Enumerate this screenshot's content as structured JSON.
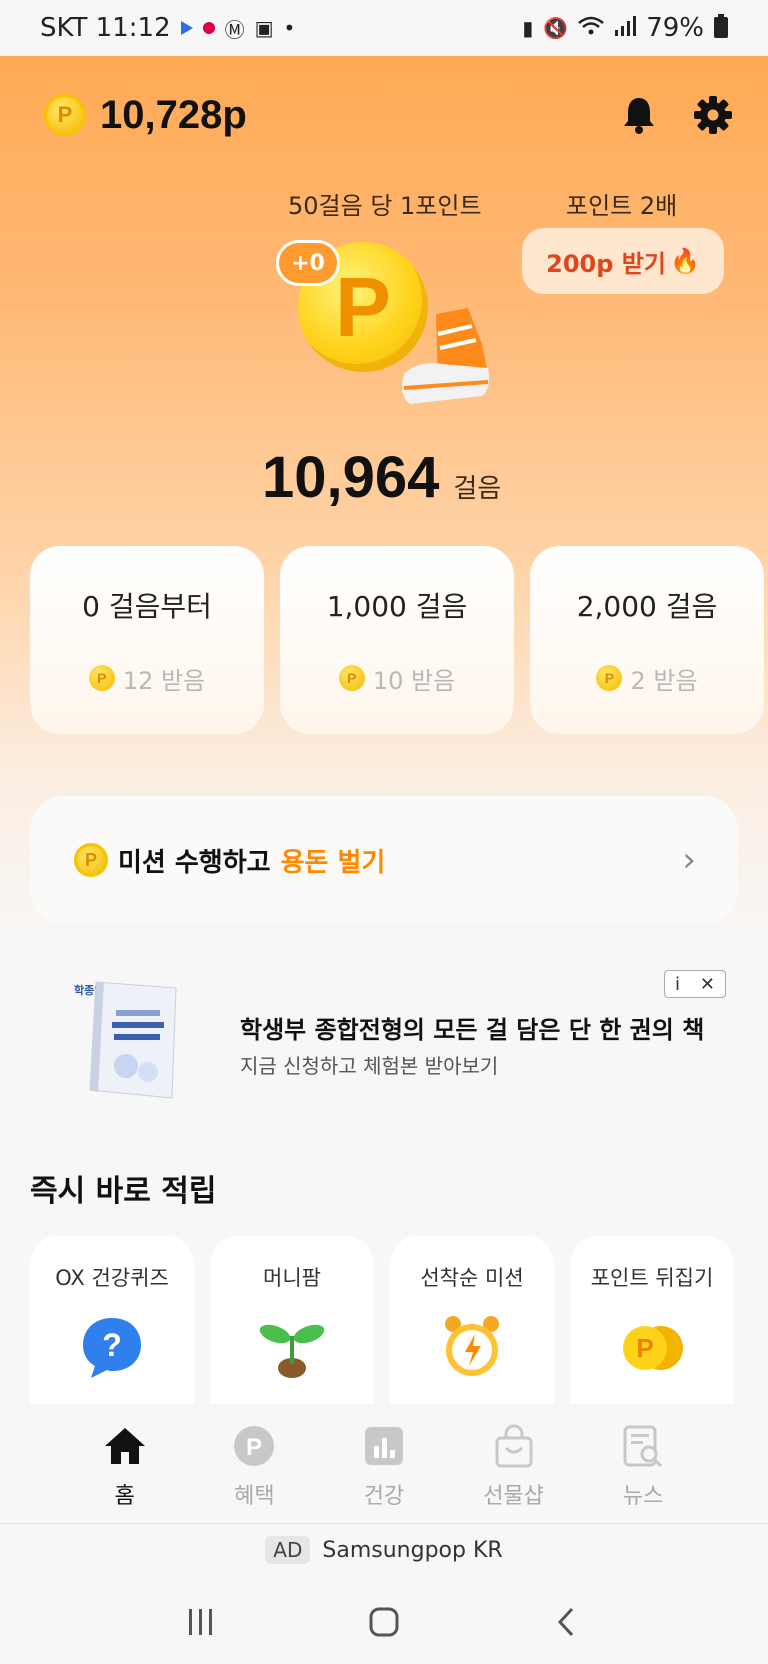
{
  "status_bar": {
    "carrier_time": "SKT 11:12",
    "battery": "79%"
  },
  "header": {
    "points": "10,728p",
    "coin_symbol": "P",
    "icons": [
      "bell-icon",
      "gear-icon"
    ]
  },
  "hero": {
    "rate_label": "50걸음 당 1포인트",
    "double_label": "포인트 2배",
    "double_button": "200p 받기",
    "double_emoji": "🔥",
    "coin_letter": "P",
    "gain_badge": "+0",
    "steps_value": "10,964",
    "steps_unit": "걸음"
  },
  "tiers": [
    {
      "title": "0 걸음부터",
      "reward": "12 받음"
    },
    {
      "title": "1,000 걸음",
      "reward": "10 받음"
    },
    {
      "title": "2,000 걸음",
      "reward": "2 받음"
    }
  ],
  "mission": {
    "text_main": "미션 수행하고",
    "text_accent": "용돈 벌기",
    "chevron": "›"
  },
  "ad_banner": {
    "brand": "학종메이트",
    "title": "학생부 종합전형의 모든 걸 담은 단 한 권의 책",
    "subtitle": "지금 신청하고 체험본 받아보기",
    "info": "i",
    "close": "✕"
  },
  "quick_section": {
    "title": "즉시 바로 적립",
    "cards": [
      {
        "label": "OX 건강퀴즈",
        "icon": "question-bubble-icon"
      },
      {
        "label": "머니팜",
        "icon": "sprout-icon"
      },
      {
        "label": "선착순 미션",
        "icon": "alarm-clock-icon"
      },
      {
        "label": "포인트 뒤집기",
        "icon": "coins-icon"
      }
    ]
  },
  "tabs": [
    {
      "label": "홈",
      "icon": "home-icon",
      "active": true
    },
    {
      "label": "혜택",
      "icon": "points-icon",
      "active": false
    },
    {
      "label": "건강",
      "icon": "chart-icon",
      "active": false
    },
    {
      "label": "선물샵",
      "icon": "shopping-bag-icon",
      "active": false
    },
    {
      "label": "뉴스",
      "icon": "news-icon",
      "active": false
    }
  ],
  "ad_line": {
    "tag": "AD",
    "text": "Samsungpop KR"
  },
  "colors": {
    "accent": "#ff8a00",
    "background_top": "#ffa64d",
    "double_text": "#e0461c"
  }
}
